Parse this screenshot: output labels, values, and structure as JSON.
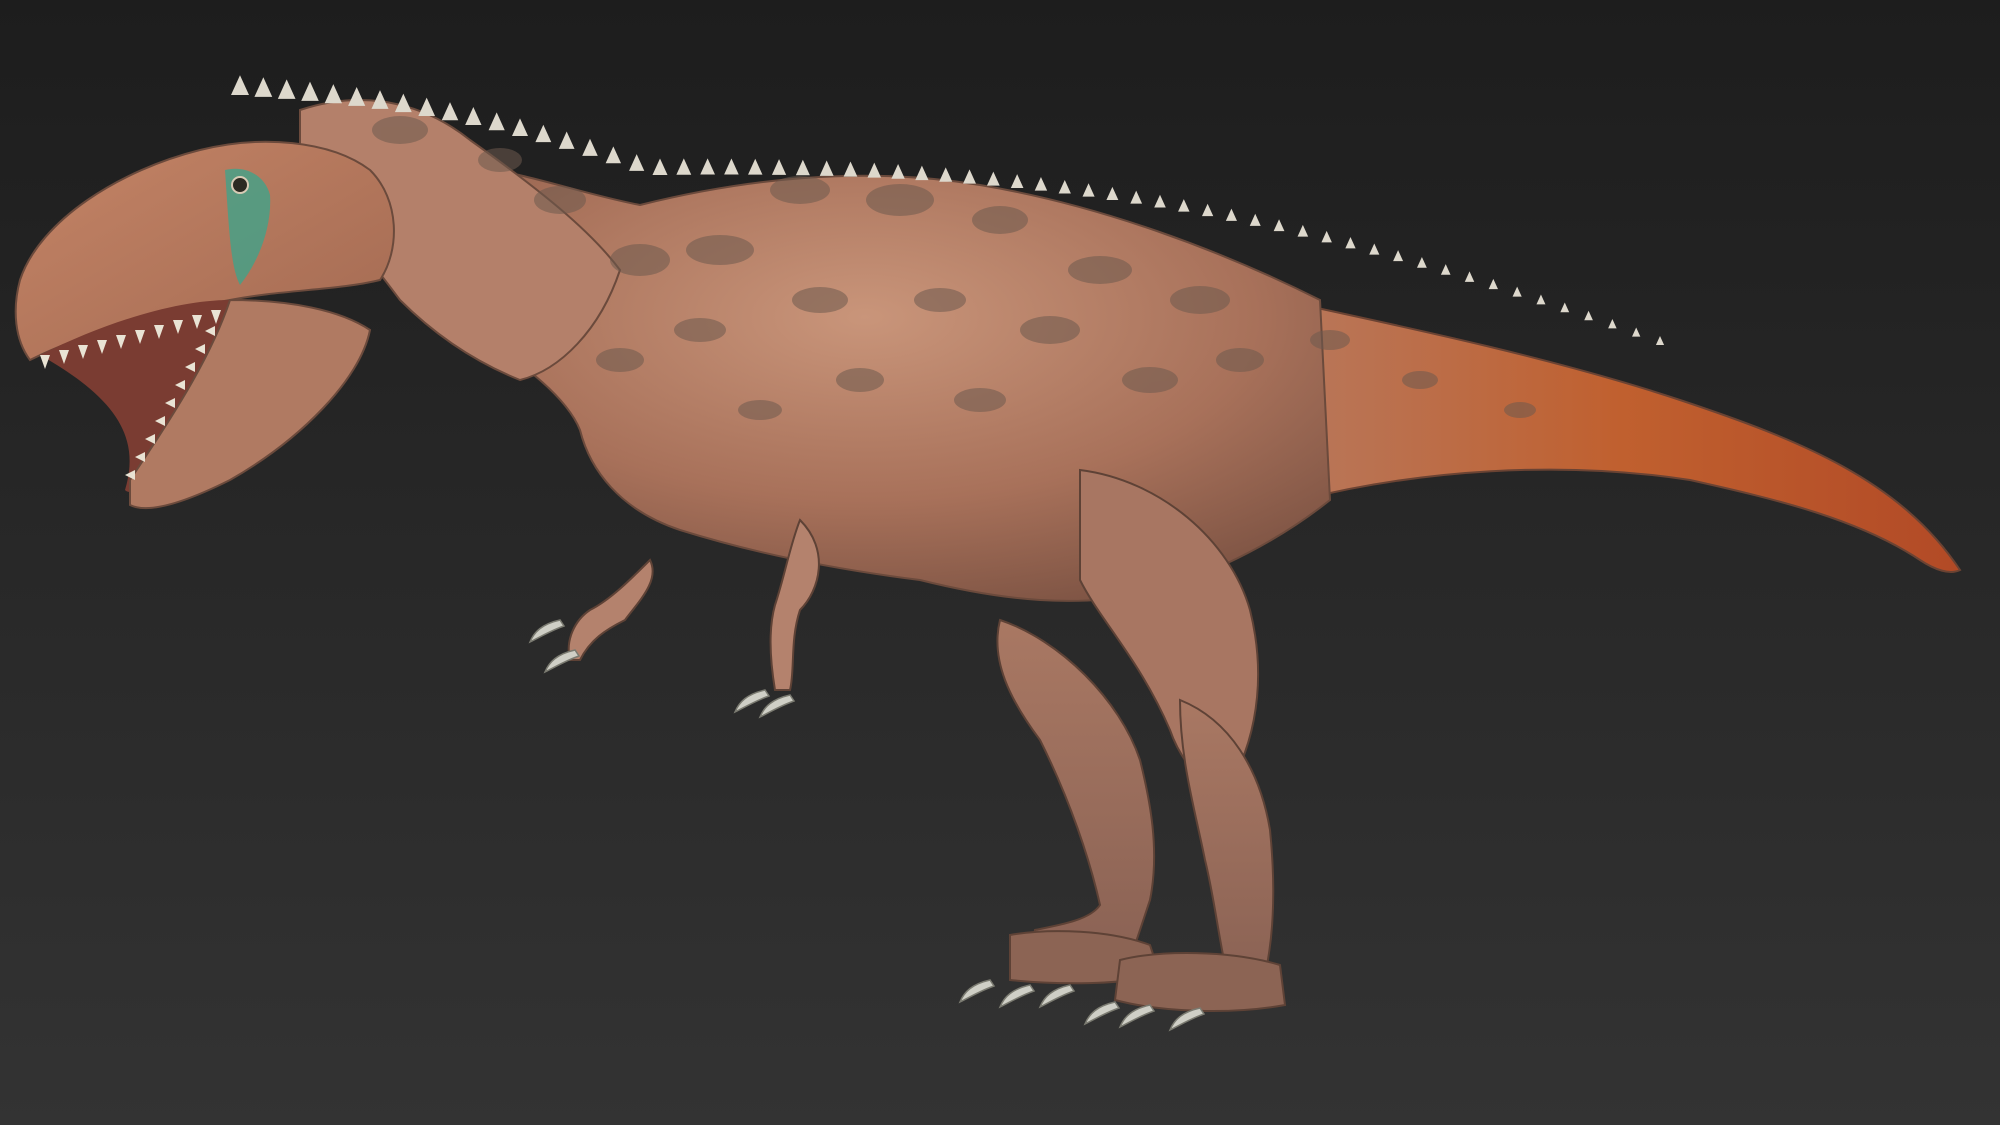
{
  "scene": {
    "subject_icon": "dinosaur-render",
    "colors": {
      "background_top": "#1d1d1d",
      "background_bottom": "#333333",
      "skin_base": "#b07a5f",
      "skin_light": "#d8b8a4",
      "skin_rust": "#c0562e",
      "spots": "#6e5a4e",
      "spines": "#ddd8cc",
      "claws": "#cfcfc6",
      "eye_patch": "#3aa58c",
      "mouth": "#7a3c32"
    }
  }
}
